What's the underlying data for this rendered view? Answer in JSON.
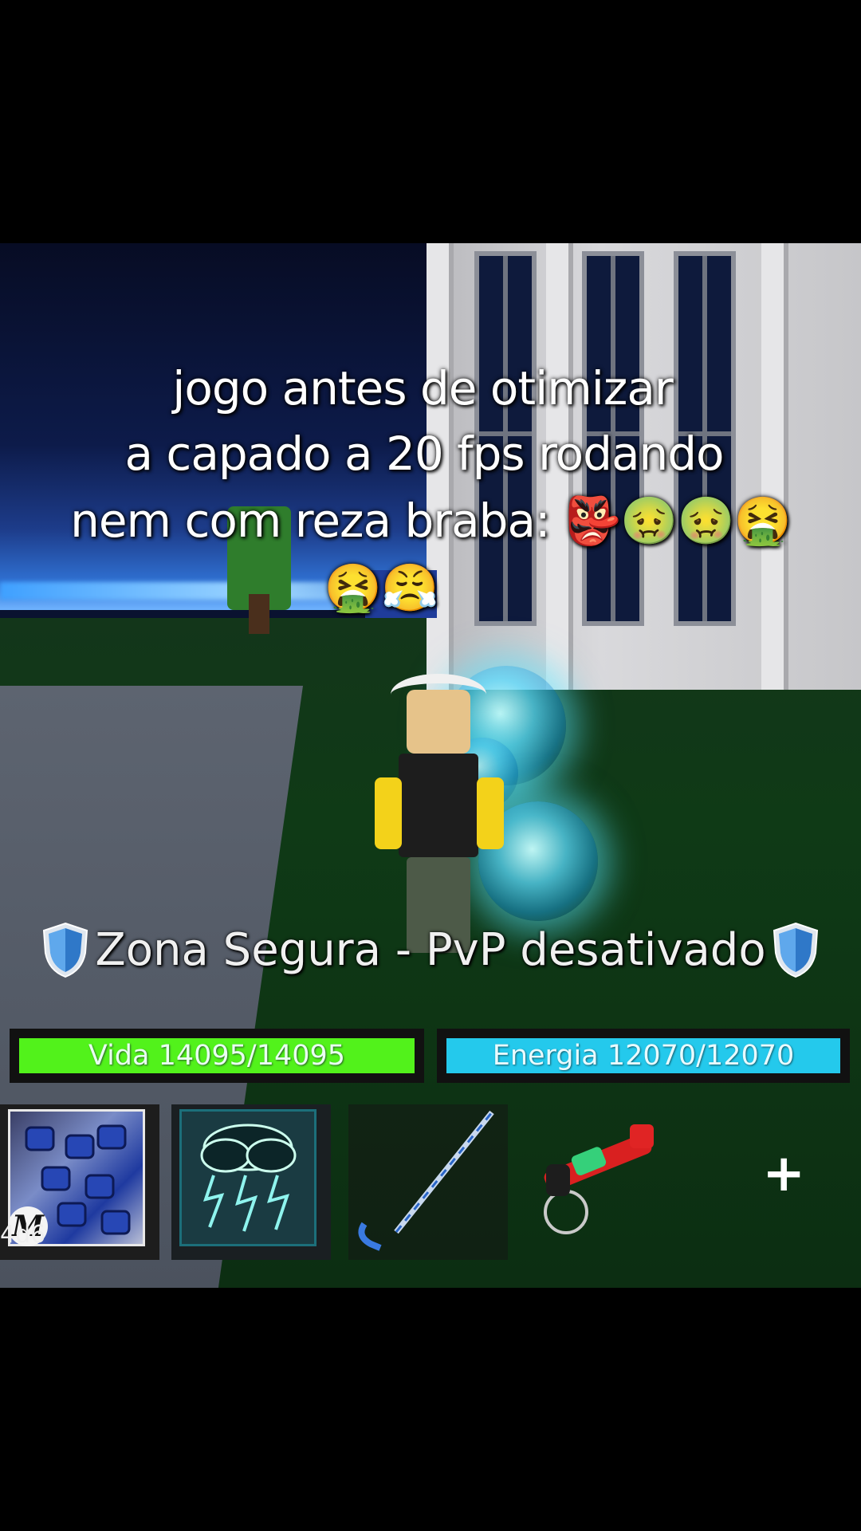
{
  "caption": {
    "line1": "jogo antes de otimizar",
    "line2": "a capado a 20 fps rodando",
    "line3": "nem com reza braba: 👺🤢🤢🤮",
    "line4": "🤮😤"
  },
  "safe_zone": {
    "text": "Zona Segura - PvP desativado",
    "icon": "shield-icon"
  },
  "health": {
    "label": "Vida 14095/14095",
    "current": 14095,
    "max": 14095,
    "fill_fraction": 1.0,
    "color": "#52f21b"
  },
  "energy": {
    "label": "Energia 12070/12070",
    "current": 12070,
    "max": 12070,
    "fill_fraction": 1.0,
    "color": "#24c9ec"
  },
  "hotbar": {
    "slots": [
      {
        "icon": "fighting-style-fists-icon",
        "tag": "4d6",
        "badge": "M"
      },
      {
        "icon": "storm-cloud-fruit-icon"
      },
      {
        "icon": "sword-staff-icon"
      },
      {
        "icon": "bazooka-gun-icon"
      }
    ],
    "add_icon": "+"
  }
}
